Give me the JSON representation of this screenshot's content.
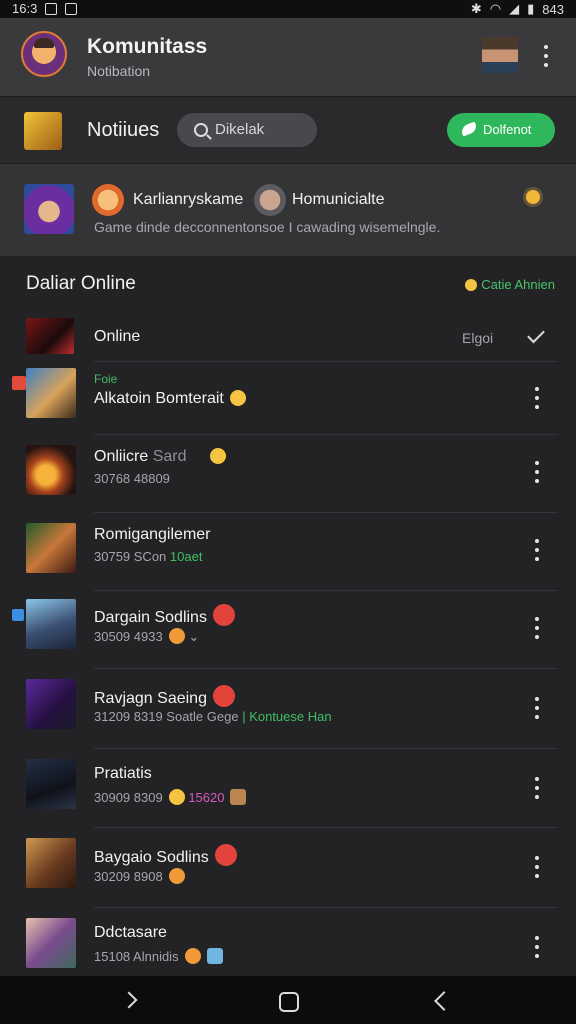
{
  "status_bar": {
    "time": "16:3",
    "battery": "843"
  },
  "app_bar": {
    "title": "Komunitass",
    "subtitle": "Notibation"
  },
  "toolbar": {
    "title": "Notiiues",
    "search_placeholder": "Dikelak",
    "follow_label": "Dolfenot"
  },
  "banner": {
    "name_1": "Karlianryskame",
    "name_2": "Homunicialte",
    "description": "Game dinde decconnentonsoe I cawading wisemelngle."
  },
  "section": {
    "title": "Daliar Online",
    "right_label": "Catie Ahnien"
  },
  "online_row": {
    "label": "Online",
    "status": "Elgoi"
  },
  "items": [
    {
      "tag": "Foie",
      "title": "Alkatoin Bomterait",
      "sub": ""
    },
    {
      "title": "Onliicre",
      "title_extra": "Sard",
      "sub": "30768 48809"
    },
    {
      "title": "Romigangilemer",
      "sub": "30759 SCon",
      "sub_extra": "10aet"
    },
    {
      "title": "Dargain Sodlins",
      "sub": "30509 4933"
    },
    {
      "title": "Ravjagn Saeing",
      "sub": "31209 8319 Soatle Gege",
      "sub_extra": "| Kontuese Han"
    },
    {
      "title": "Pratiatis",
      "sub": "30909 8309",
      "sub_extra": "15620"
    },
    {
      "title": "Baygaio Sodlins",
      "sub": "30209 8908"
    },
    {
      "title": "Ddctasare",
      "sub": "15108 Alnnidis"
    }
  ],
  "colors": {
    "accent_green": "#2fb85b",
    "badge_red": "#e2443b",
    "background": "#232325"
  }
}
